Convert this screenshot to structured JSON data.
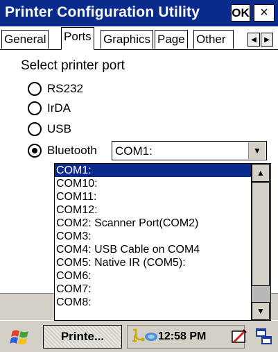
{
  "window": {
    "title": "Printer Configuration Utility",
    "ok_label": "OK",
    "close_glyph": "×"
  },
  "tabs": [
    {
      "label": "General",
      "active": false
    },
    {
      "label": "Ports",
      "active": true
    },
    {
      "label": "Graphics",
      "active": false
    },
    {
      "label": "Page",
      "active": false
    },
    {
      "label": "Other",
      "active": false
    }
  ],
  "tab_scroll": {
    "left_icon": "◀",
    "right_icon": "▶"
  },
  "port": {
    "section_label": "Select printer port",
    "options": [
      {
        "label": "RS232",
        "checked": false
      },
      {
        "label": "IrDA",
        "checked": false
      },
      {
        "label": "USB",
        "checked": false
      },
      {
        "label": "Bluetooth",
        "checked": true
      }
    ],
    "combo_value": "COM1:",
    "combo_arrow": "▼",
    "dropdown_items": [
      "COM1:",
      "COM10:",
      "COM11:",
      "COM12:",
      "COM2: Scanner Port(COM2)",
      "COM3:",
      "COM4: USB Cable on COM4",
      "COM5: Native IR (COM5):",
      "COM6:",
      "COM7:",
      "COM8:"
    ],
    "selected_index": 0,
    "scroll_up": "▲",
    "scroll_down": "▼"
  },
  "taskbar": {
    "task_label": "Printe...",
    "clock": "12:58 PM"
  },
  "colors": {
    "title_bg": "#0a2a8c",
    "selection_bg": "#0a2a8c",
    "chrome_gray": "#d4d0c8"
  }
}
